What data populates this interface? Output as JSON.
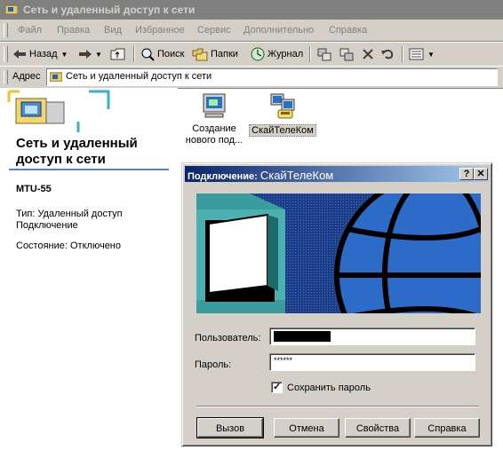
{
  "window": {
    "title": "Сеть и удаленный доступ к сети"
  },
  "menu": [
    "Файл",
    "Правка",
    "Вид",
    "Избранное",
    "Сервис",
    "Дополнительно",
    "Справка"
  ],
  "toolbar": {
    "back": "Назад",
    "search": "Поиск",
    "folders": "Папки",
    "history": "Журнал"
  },
  "address": {
    "label": "Адрес",
    "value": "Сеть и удаленный доступ к сети"
  },
  "left_panel": {
    "title": "Сеть и удаленный доступ к сети",
    "connection_name": "MTU-55",
    "type_text": "Тип: Удаленный доступ Подключение",
    "status_text": "Состояние: Отключено"
  },
  "icons": [
    {
      "label": "Создание нового под..."
    },
    {
      "label": "СкайТелеКом"
    }
  ],
  "dialog": {
    "title_prefix": "Подключение:",
    "title_name": "СкайТелеКом",
    "help_btn": "?",
    "close_btn": "✕",
    "user_label": "Пользователь:",
    "password_label": "Пароль:",
    "password_value": "******",
    "save_password": "Сохранить пароль",
    "save_password_checked": true,
    "buttons": {
      "dial": "Вызов",
      "cancel": "Отмена",
      "properties": "Свойства",
      "help": "Справка"
    }
  }
}
